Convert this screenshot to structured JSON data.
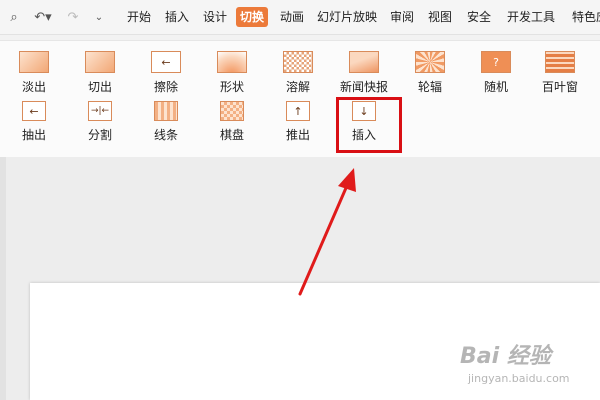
{
  "menubar": {
    "items": [
      {
        "label": "开始",
        "active": false
      },
      {
        "label": "插入",
        "active": false
      },
      {
        "label": "设计",
        "active": false
      },
      {
        "label": "切换",
        "active": true
      },
      {
        "label": "动画",
        "active": false
      },
      {
        "label": "幻灯片放映",
        "active": false
      },
      {
        "label": "审阅",
        "active": false
      },
      {
        "label": "视图",
        "active": false
      },
      {
        "label": "安全",
        "active": false
      },
      {
        "label": "开发工具",
        "active": false
      },
      {
        "label": "特色应",
        "active": false
      }
    ],
    "accent_color": "#ec7a3a"
  },
  "ribbon": {
    "row1": [
      {
        "label": "淡出",
        "icon": "fade-icon"
      },
      {
        "label": "切出",
        "icon": "cut-icon"
      },
      {
        "label": "擦除",
        "icon": "wipe-icon"
      },
      {
        "label": "形状",
        "icon": "shape-icon"
      },
      {
        "label": "溶解",
        "icon": "dissolve-icon"
      },
      {
        "label": "新闻快报",
        "icon": "newsflash-icon"
      },
      {
        "label": "轮辐",
        "icon": "wheel-icon"
      },
      {
        "label": "随机",
        "icon": "random-icon"
      },
      {
        "label": "百叶窗",
        "icon": "blinds-icon"
      }
    ],
    "row2": [
      {
        "label": "抽出",
        "icon": "pull-icon"
      },
      {
        "label": "分割",
        "icon": "split-icon"
      },
      {
        "label": "线条",
        "icon": "lines-icon"
      },
      {
        "label": "棋盘",
        "icon": "checkerboard-icon"
      },
      {
        "label": "推出",
        "icon": "push-icon"
      },
      {
        "label": "插入",
        "icon": "cover-icon"
      }
    ],
    "highlight_color": "#d90f14"
  },
  "watermark": {
    "brand": "Bai 经验",
    "url": "jingyan.baidu.com"
  }
}
